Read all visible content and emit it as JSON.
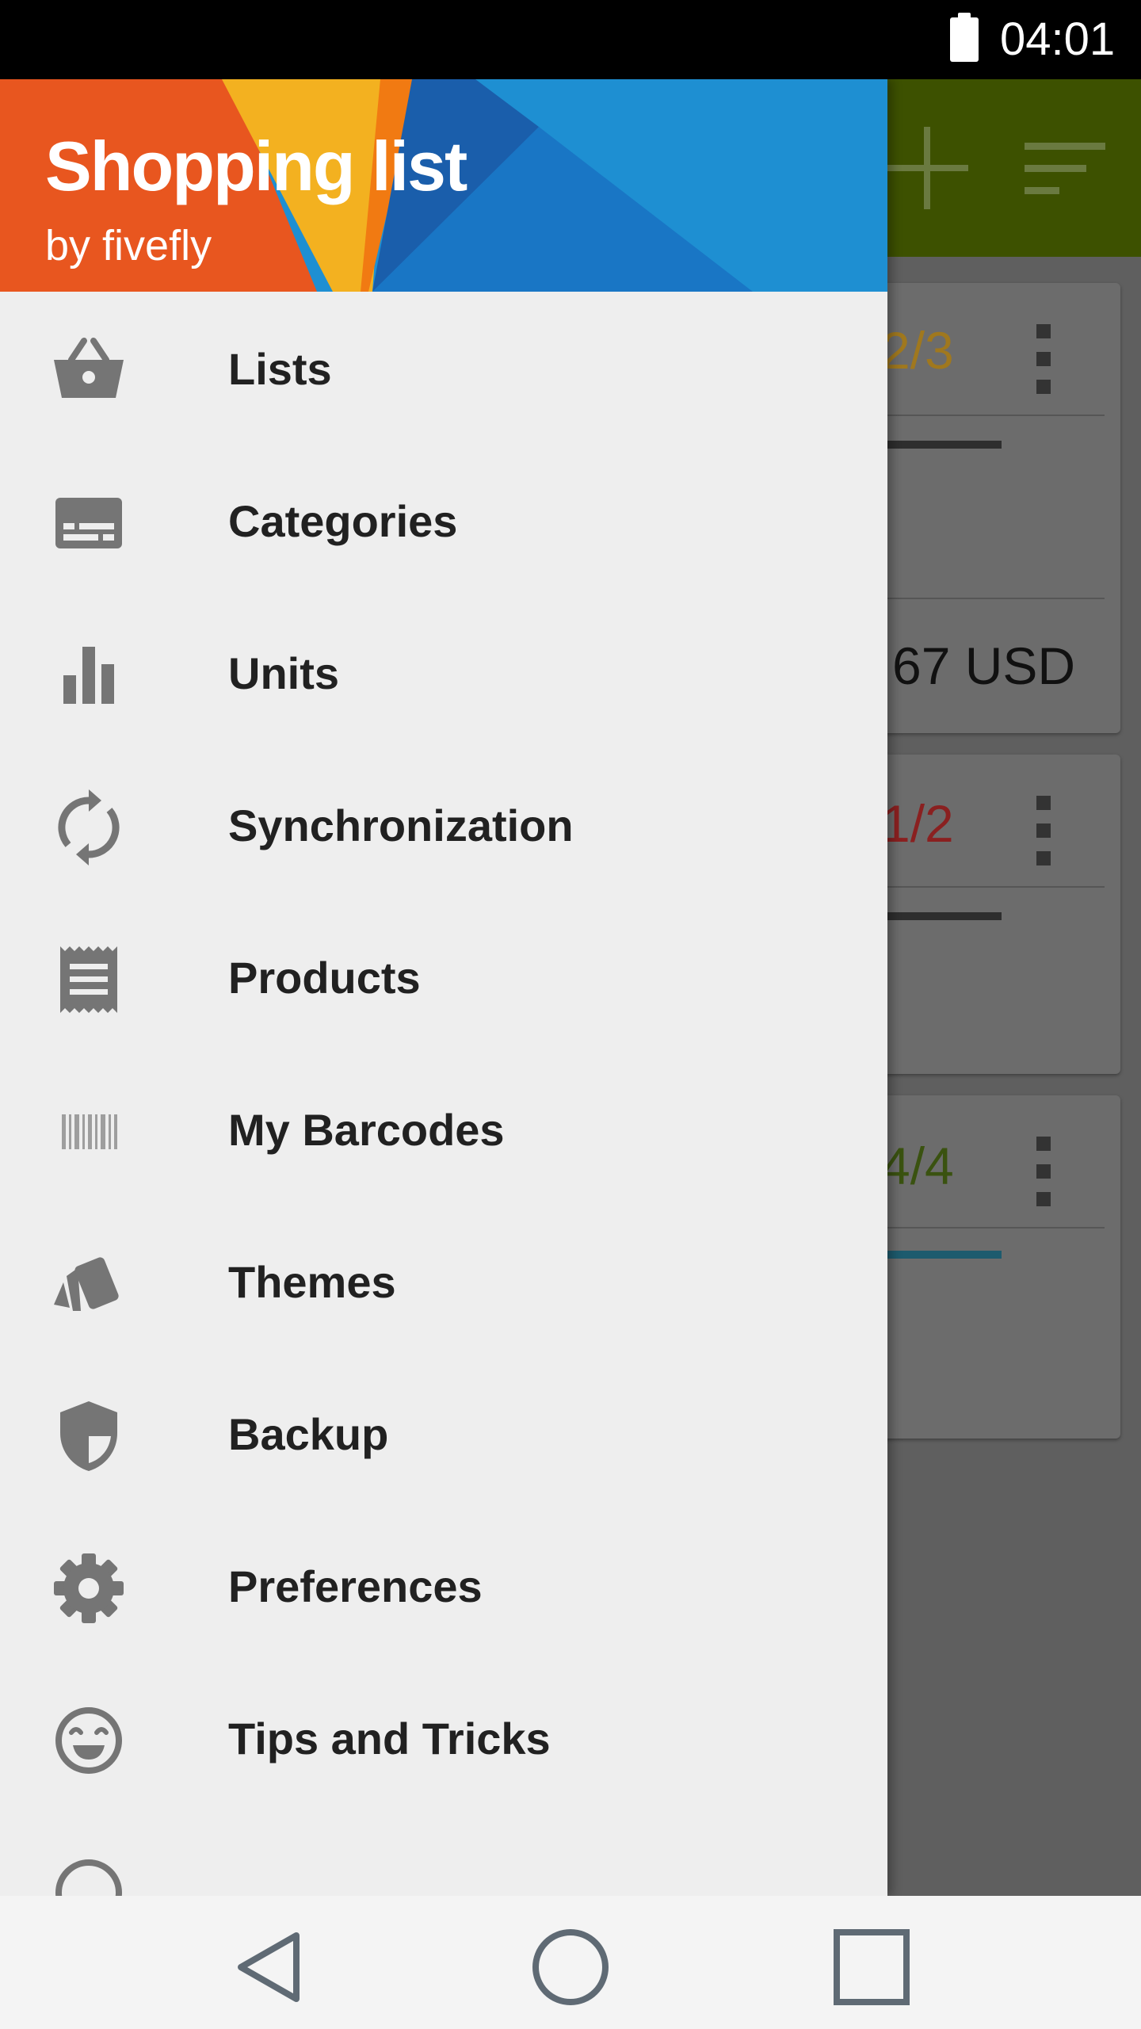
{
  "status_bar": {
    "time": "04:01",
    "battery_icon": "battery-full-icon"
  },
  "app_toolbar": {
    "add_icon": "plus-icon",
    "sort_icon": "sort-icon"
  },
  "background_cards": [
    {
      "count": "2/3",
      "count_color": "#a0781e",
      "bar_color": "#2e2e2e",
      "total": "67 USD"
    },
    {
      "count": "1/2",
      "count_color": "#8a2020",
      "bar_color": "#2e2e2e"
    },
    {
      "count": "4/4",
      "count_color": "#3a5210",
      "bar_color": "#1d5b6e"
    }
  ],
  "drawer": {
    "title": "Shopping list",
    "subtitle": "by fivefly",
    "items": [
      {
        "label": "Lists",
        "icon": "basket-icon"
      },
      {
        "label": "Categories",
        "icon": "subtitles-icon"
      },
      {
        "label": "Units",
        "icon": "bar-chart-icon"
      },
      {
        "label": "Synchronization",
        "icon": "sync-icon"
      },
      {
        "label": "Products",
        "icon": "receipt-icon"
      },
      {
        "label": "My Barcodes",
        "icon": "barcode-icon"
      },
      {
        "label": "Themes",
        "icon": "swatches-icon"
      },
      {
        "label": "Backup",
        "icon": "shield-icon"
      },
      {
        "label": "Preferences",
        "icon": "gear-icon"
      },
      {
        "label": "Tips and Tricks",
        "icon": "smiley-icon"
      }
    ]
  },
  "nav_bar": {
    "back_icon": "back-triangle-icon",
    "home_icon": "home-circle-icon",
    "recents_icon": "recents-square-icon"
  },
  "colors": {
    "drawer_bg": "#eeeeee",
    "toolbar_green": "#3d5100",
    "header_orange": "#e8561f",
    "header_blue": "#1e8fd2",
    "icon_gray": "#757575"
  }
}
